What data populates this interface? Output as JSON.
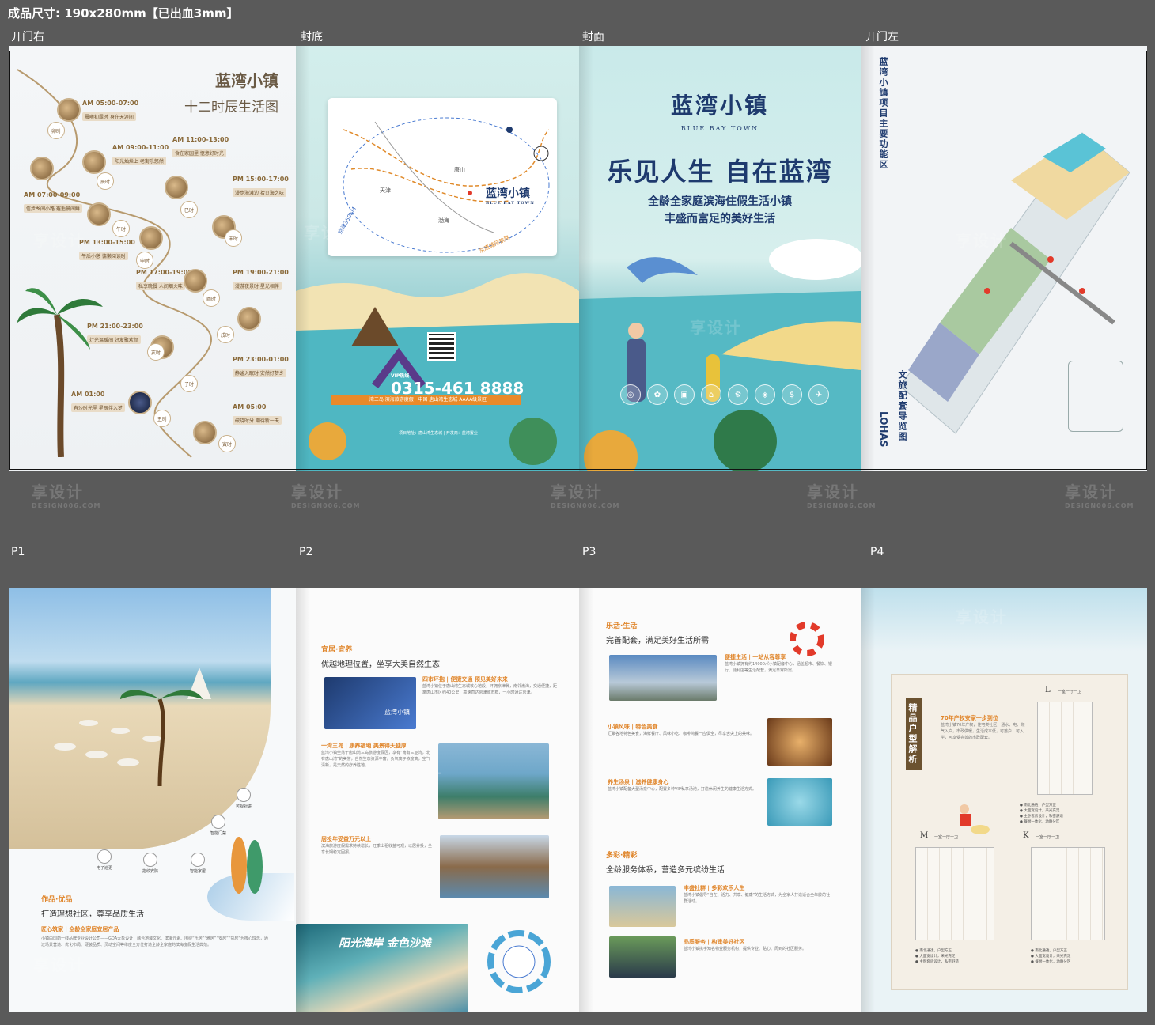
{
  "header": "成品尺寸: 190x280mm【已出血3mm】",
  "rows": {
    "top": [
      "开门右",
      "封底",
      "封面",
      "开门左"
    ],
    "bottom": [
      "P1",
      "P2",
      "P3",
      "P4"
    ]
  },
  "watermark": {
    "zh": "享设计",
    "en": "DESIGN006.COM"
  },
  "open_right": {
    "title1": "蓝湾小镇",
    "title2": "十二时辰生活图",
    "items": [
      {
        "time": "AM 05:00-07:00",
        "tag": "晨曦初露时 身在天涯间",
        "shichen": "卯时"
      },
      {
        "time": "AM 07:00-09:00",
        "tag": "信步乡间小路 邂逅晨间鲜",
        "shichen": "辰时"
      },
      {
        "time": "AM 09:00-11:00",
        "tag": "阳光灿烂上 老街乐悠然",
        "shichen": "巳时"
      },
      {
        "time": "AM 11:00-13:00",
        "tag": "食在家园里 惬意好时光",
        "shichen": "午时"
      },
      {
        "time": "PM 13:00-15:00",
        "tag": "午后小憩 慵懒阅读时",
        "shichen": "未时"
      },
      {
        "time": "PM 15:00-17:00",
        "tag": "漫步海滩边 拾贝海之味",
        "shichen": "申时"
      },
      {
        "time": "PM 17:00-19:00",
        "tag": "私享晚餐 人间烟火味",
        "shichen": "酉时"
      },
      {
        "time": "PM 19:00-21:00",
        "tag": "漫游夜景时 星光相伴",
        "shichen": "戌时"
      },
      {
        "time": "PM 21:00-23:00",
        "tag": "灯光温暖间 好友聚欢颜",
        "shichen": "亥时"
      },
      {
        "time": "PM 23:00-01:00",
        "tag": "静谧入眠时 安然好梦乡",
        "shichen": "子时"
      },
      {
        "time": "AM 01:00",
        "tag": "春沙时光里 星辰伴入梦",
        "shichen": "丑时"
      },
      {
        "time": "AM 05:00",
        "tag": "破晓时分 期待新一天",
        "shichen": "寅时"
      }
    ]
  },
  "back_cover": {
    "logo": "蓝湾小镇",
    "logo_en": "BLUE BAY TOWN",
    "map_labels": [
      "唐山",
      "天津",
      "渤海",
      "京津350KM",
      "京唐城际铁路"
    ],
    "hotline_label": "VIP热线",
    "hotline": "0315-461 8888",
    "banner": "一湾三岛 滨海旅游度假 · 中国·唐山湾生态城 AAAA级景区",
    "footer": "项目地址：唐山湾生态城 | 开发商：蓝湾置业"
  },
  "cover": {
    "logo": "蓝湾小镇",
    "logo_en": "BLUE BAY TOWN",
    "slogan": "乐见人生 自在蓝湾",
    "sub1": "全龄全家庭滨海住假生活小镇",
    "sub2": "丰盛而富足的美好生活",
    "icons": [
      "◎",
      "✿",
      "▣",
      "⌂",
      "⚙",
      "◈",
      "$",
      "✈"
    ]
  },
  "open_left": {
    "title": "蓝湾小镇项目主要功能区",
    "guide": "文旅配套导览图",
    "lohas": "LOHAS"
  },
  "p1": {
    "hd": "作品·优品",
    "sub": "打造理想社区，尊享品质生活",
    "item": "匠心筑家 | 全龄全家庭宜居产品",
    "body": "小镇由国药一线品牌专业设计公司——GOA大象设计，融合地域文化、滨海元素、围绕“乐居”“雅居”“安居”“益居”为核心理念，通过场景营造、优化布局、硬装品质、灵动空间等维度全方位打造全龄全家庭的滨海度假生活典范。",
    "icons": [
      "可视对讲",
      "智能门禁",
      "电子巡更",
      "指纹安防",
      "智能家居"
    ]
  },
  "p2": {
    "hd": "宜居·宜养",
    "title": "优越地理位置，坐享大美自然生态",
    "b1_title": "四市环抱 | 便捷交通 预见美好未来",
    "b1_body": "蓝湾小镇位于唐山湾生态城核心地段，环拥京津冀，南邻渤海，交通便捷，距离唐山市区约40公里，高速直达京津城市群，一小时通达京津。",
    "b2_title": "一湾三岛 | 康养福地 美景得天独厚",
    "b2_body": "蓝湾小镇坐落于唐山湾三岛旅游度假区，享有“南有三亚湾，北有唐山湾”的美誉，自然生态资源丰富，负氧离子浓度高，空气清新，是天然的疗养胜地。",
    "b3_title": "居投年受益万元以上",
    "b3_body": "滨海旅游度假需求持续增长，旺季出租收益可观，以居养投，坐享长期稳定回报。",
    "map_text": "阳光海岸 金色沙滩",
    "map_logo": "蓝湾小镇"
  },
  "p3": {
    "hd": "乐活·生活",
    "title": "完善配套，满足美好生活所需",
    "b1_title": "便捷生活 | 一站从容尊享",
    "b1_body": "蓝湾小镇拥有约14000㎡小镇配套中心，涵盖超市、餐饮、银行、便利店等生活配套，满足日常所需。",
    "b2_title": "小镇风味 | 特色美食",
    "b2_body": "汇聚各地特色美食，海鲜餐厅、风味小吃、咖啡简餐一应俱全，尽享舌尖上的美味。",
    "b3_title": "养生汤泉 | 滋养健康身心",
    "b3_body": "蓝湾小镇配备大型汤泉中心，配置多种VIP私享汤池，打造休闲养生的健康生活方式。",
    "hd2": "多彩·精彩",
    "title2": "全龄服务体系，营造多元缤纷生活",
    "b4_title": "丰盛社群 | 多彩欢乐人生",
    "b4_body": "蓝湾小镇倡导“自在、活力、共享、健康”的生活方式，为全家人打造适合全年龄的社群活动。",
    "b5_title": "品质服务 | 构建美好社区",
    "b5_body": "蓝湾小镇携手知名物业服务机构，提供专业、贴心、周到的社区服务。"
  },
  "p4": {
    "label": "精品户型解析",
    "intro_title": "70年产权安家一步到位",
    "intro_body": "蓝湾小镇70年产权，住宅类社区，通水、电、燃气入户，市政供暖，生活成本低，可落户、可入学，可享受完善的市政配套。",
    "types": [
      {
        "tag": "L",
        "area": "一室一厅一卫"
      },
      {
        "tag": "M",
        "area": "一室一厅一卫"
      },
      {
        "tag": "K",
        "area": "一室一厅一卫"
      }
    ],
    "notes": [
      "● 南北通透，户型方正",
      "● 大面宽设计，采光充足",
      "● 主卧套房设计，私密舒适",
      "● 餐厨一体化，动静分区"
    ]
  }
}
